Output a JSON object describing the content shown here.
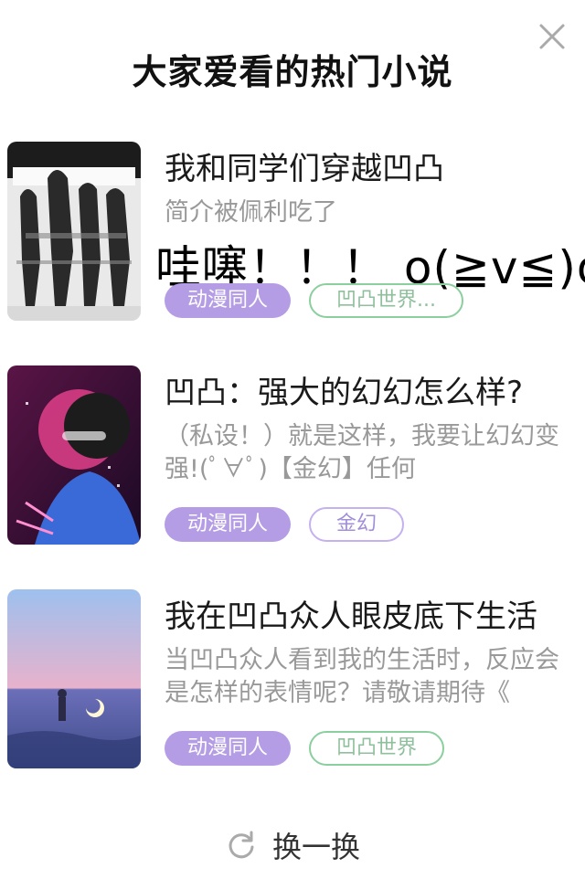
{
  "dialog": {
    "title": "大家爱看的热门小说",
    "close_icon": "close-icon"
  },
  "books": [
    {
      "title": "我和同学们穿越凹凸",
      "description": "简介被佩利吃了",
      "extra": "哇噻！！！ o(≧v≦)o",
      "tags": [
        "动漫同人",
        "凹凸世界..."
      ],
      "cover_colors": [
        "#f2f2f2",
        "#2b2b2b"
      ]
    },
    {
      "title": "凹凸：强大的幻幻怎么样?",
      "description": "（私设！）就是这样，我要让幻幻变强!(ﾟ∀ﾟ)【金幻】任何",
      "tags": [
        "动漫同人",
        "金幻"
      ],
      "cover_colors": [
        "#3a1238",
        "#e0408a"
      ]
    },
    {
      "title": "我在凹凸众人眼皮底下生活",
      "description": "当凹凸众人看到我的生活时，反应会是怎样的表情呢？请敬请期待《",
      "tags": [
        "动漫同人",
        "凹凸世界"
      ],
      "cover_colors": [
        "#8fb3e8",
        "#e8a3c0"
      ]
    }
  ],
  "footer": {
    "refresh_label": "换一换",
    "refresh_icon": "refresh-icon"
  },
  "colors": {
    "primary_tag": "#b49de5",
    "outline_green": "#8ccf9f",
    "outline_purple": "#c5b1ee"
  }
}
